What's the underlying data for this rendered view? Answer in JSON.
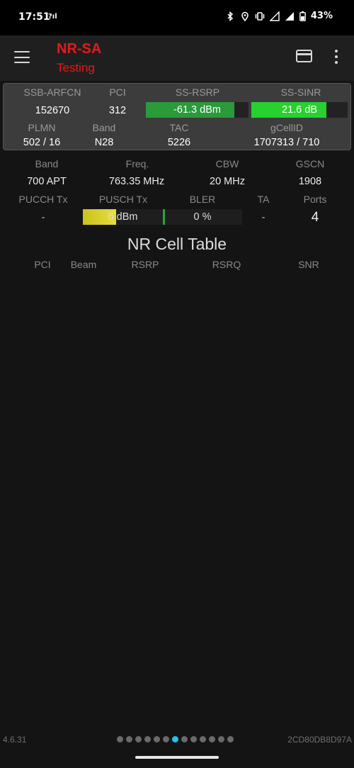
{
  "status_bar": {
    "time": "17:51",
    "net_label": "?ıl",
    "battery": "43%",
    "icons": [
      "bluetooth-icon",
      "location-icon",
      "vibrate-icon",
      "signal-roaming-icon",
      "signal-icon",
      "battery-icon"
    ]
  },
  "app_bar": {
    "title": "NR-SA",
    "subtitle": "Testing",
    "title_color": "#e21b1b"
  },
  "serving": {
    "labels": {
      "arfcn": "SSB-ARFCN",
      "pci": "PCI",
      "rsrp": "SS-RSRP",
      "sinr": "SS-SINR",
      "plmn": "PLMN",
      "band": "Band",
      "tac": "TAC",
      "gcellid": "gCellID"
    },
    "values": {
      "arfcn": "152670",
      "pci": "312",
      "rsrp": "-61.3 dBm",
      "sinr": "21.6 dB",
      "plmn": "502 / 16",
      "band": "N28",
      "tac": "5226",
      "gcellid": "1707313 / 710"
    },
    "rsrp_fill": 0.86,
    "sinr_fill": 0.78,
    "rsrp_color": "#2a9a3a",
    "sinr_color": "#27d12f"
  },
  "details": {
    "labels": {
      "band": "Band",
      "freq": "Freq.",
      "cbw": "CBW",
      "gscn": "GSCN"
    },
    "values": {
      "band": "700 APT",
      "freq": "763.35 MHz",
      "cbw": "20 MHz",
      "gscn": "1908"
    }
  },
  "tx": {
    "labels": {
      "pucch": "PUCCH Tx",
      "pusch": "PUSCH Tx",
      "bler": "BLER",
      "ta": "TA",
      "ports": "Ports"
    },
    "values": {
      "pucch": "-",
      "pusch": "6 dBm",
      "bler": "0 %",
      "ta": "-",
      "ports": "4"
    },
    "pusch_fill": 0.42,
    "bler_fill": 0.0
  },
  "cell_table": {
    "title": "NR Cell Table",
    "columns": [
      "PCI",
      "Beam",
      "RSRP",
      "RSRQ",
      "SNR"
    ]
  },
  "footer": {
    "version": "4.6.31",
    "device_id": "2CD80DB8D97A",
    "page_count": 13,
    "active_page": 6,
    "active_color": "#22c4ee"
  }
}
